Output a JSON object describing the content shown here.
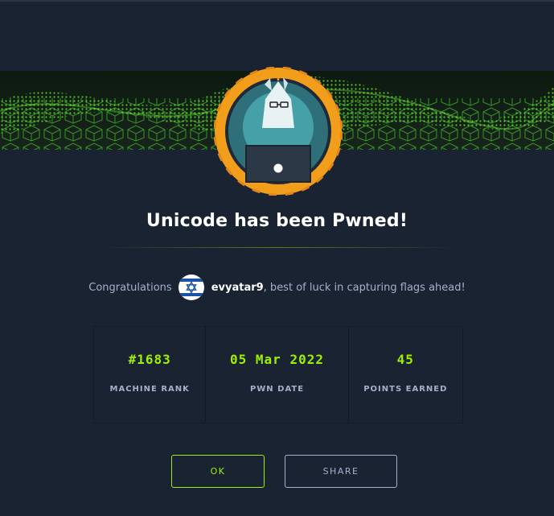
{
  "title": "Unicode has been Pwned!",
  "congrats": {
    "lead": "Congratulations",
    "username": "evyatar9",
    "trail": ", best of luck in capturing flags ahead!",
    "flag_icon": "israel-flag-icon"
  },
  "stats": [
    {
      "value": "#1683",
      "label": "MACHINE RANK"
    },
    {
      "value": "05 Mar 2022",
      "label": "PWN DATE"
    },
    {
      "value": "45",
      "label": "POINTS EARNED"
    }
  ],
  "buttons": {
    "ok": "OK",
    "share": "SHARE"
  },
  "colors": {
    "background": "#1a2332",
    "accent": "#9fef00",
    "muted": "#a4b1cd",
    "ring": "#f29e1b",
    "text": "#ffffff"
  }
}
